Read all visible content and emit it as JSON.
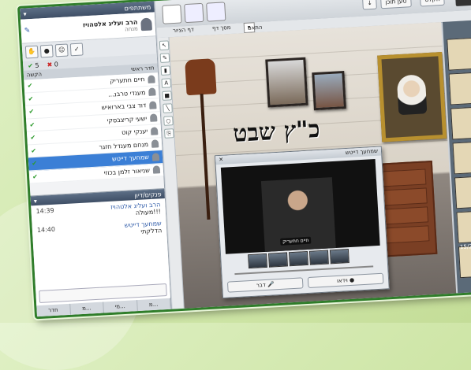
{
  "participants": {
    "title": "משתתפים",
    "host": {
      "name": "הרב ועליג אלטהויז",
      "role": "מנחה"
    },
    "count_present": "5",
    "count_absent": "0",
    "column_header": "חדר ראשי",
    "column_header_right": "הקשה",
    "list": [
      {
        "name": "חיים חתעריק"
      },
      {
        "name": "מענדי טרבנ..."
      },
      {
        "name": "דוד צבי בארואיש"
      },
      {
        "name": "ישעי קריצבסקי"
      },
      {
        "name": "יענקי קוט"
      },
      {
        "name": "מנחם מענדל חזגר"
      },
      {
        "name": "שמחעך דייטש",
        "selected": true
      },
      {
        "name": "שניאור זלמן בכוזי"
      }
    ]
  },
  "chat": {
    "title": "פנקים/דיון",
    "messages": [
      {
        "sender": "הרב ועליג אלטהויז",
        "time": "14:39",
        "text": "!!!מעולה"
      },
      {
        "sender": "שמחעך דייטש",
        "time": "14:40",
        "text": "הדלקתי"
      }
    ]
  },
  "bottom_tabs": [
    "חדר",
    "מ...",
    "מי...",
    "מ..."
  ],
  "toolbar": {
    "help": "הקלט",
    "load_content": "טען תוכן",
    "dropdown": "התאם לדף",
    "page_label": "דף הציור",
    "page_label2": "מסך דף"
  },
  "whiteboard": {
    "title_text": "כ\"ץ שבט"
  },
  "video": {
    "title": "שמחעך דייטש",
    "caption": "חיים חתעריק",
    "speak_button": "דבר",
    "video_button": "וידאו"
  },
  "slides": {
    "counter": "15/21"
  }
}
